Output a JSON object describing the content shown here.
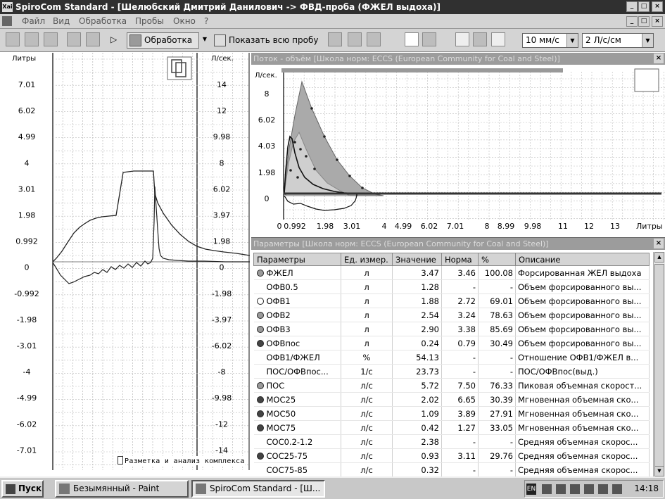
{
  "window": {
    "app_icon": "Xai",
    "title": "SpiroCom Standard - [Шелюбский Дмитрий Данилович -> ФВД-проба (ФЖЕЛ выдоха)]",
    "controls": [
      "_",
      "□",
      "×"
    ],
    "doc_controls": [
      "_",
      "□",
      "×"
    ]
  },
  "menu": [
    "Файл",
    "Вид",
    "Обработка",
    "Пробы",
    "Окно",
    "?"
  ],
  "toolbar": {
    "process_label": "Обработка",
    "show_label": "Показать всю пробу",
    "speed": "10 мм/с",
    "scale": "2 Л/с/см"
  },
  "volume_time": {
    "left_unit": "Литры",
    "right_unit": "Л/сек.",
    "left_ticks": [
      "7.01",
      "6.02",
      "4.99",
      "4",
      "3.01",
      "1.98",
      "0.992",
      "0",
      "-0.992",
      "-1.98",
      "-3.01",
      "-4",
      "-4.99",
      "-6.02",
      "-7.01"
    ],
    "right_ticks": [
      "14",
      "12",
      "9.98",
      "8",
      "6.02",
      "3.97",
      "1.98",
      "0",
      "-1.98",
      "-3.97",
      "-6.02",
      "-8",
      "-9.98",
      "-12",
      "-14"
    ],
    "hint": "Разметка и анализ комплекса"
  },
  "flow_volume": {
    "title": "Поток - объём   [Школа норм: ECCS (European Community for Coal and Steel)]",
    "y_unit": "Л/сек.",
    "y_ticks": [
      "8",
      "6.02",
      "4.03",
      "1.98",
      "0"
    ],
    "x_ticks": [
      "0",
      "0.992",
      "1.98",
      "3.01",
      "4",
      "4.99",
      "6.02",
      "7.01",
      "8",
      "8.99",
      "9.98",
      "11",
      "12",
      "13"
    ],
    "x_unit": "Литры"
  },
  "params": {
    "title": "Параметры   [Школа норм: ECCS (European Community for Coal and Steel)]",
    "columns": [
      "Параметры",
      "Ед. измер.",
      "Значение",
      "Норма",
      "%",
      "Описание"
    ],
    "rows": [
      {
        "marker": "gray",
        "name": "ФЖЕЛ",
        "unit": "л",
        "value": "3.47",
        "norm": "3.46",
        "pct": "100.08",
        "desc": "Форсированная ЖЕЛ выдоха"
      },
      {
        "marker": "",
        "name": "ОФВ0.5",
        "unit": "л",
        "value": "1.28",
        "norm": "-",
        "pct": "-",
        "desc": "Объем форсированного вы..."
      },
      {
        "marker": "white",
        "name": "ОФВ1",
        "unit": "л",
        "value": "1.88",
        "norm": "2.72",
        "pct": "69.01",
        "desc": "Объем форсированного вы..."
      },
      {
        "marker": "gray",
        "name": "ОФВ2",
        "unit": "л",
        "value": "2.54",
        "norm": "3.24",
        "pct": "78.63",
        "desc": "Объем форсированного вы..."
      },
      {
        "marker": "gray",
        "name": "ОФВ3",
        "unit": "л",
        "value": "2.90",
        "norm": "3.38",
        "pct": "85.69",
        "desc": "Объем форсированного вы..."
      },
      {
        "marker": "dark",
        "name": "ОФВпос",
        "unit": "л",
        "value": "0.24",
        "norm": "0.79",
        "pct": "30.49",
        "desc": "Объем форсированного вы..."
      },
      {
        "marker": "",
        "name": "ОФВ1/ФЖЕЛ",
        "unit": "%",
        "value": "54.13",
        "norm": "-",
        "pct": "-",
        "desc": "Отношение ОФВ1/ФЖЕЛ в..."
      },
      {
        "marker": "",
        "name": "ПОС/ОФВпос...",
        "unit": "1/с",
        "value": "23.73",
        "norm": "-",
        "pct": "-",
        "desc": "ПОС/ОФВпос(выд.)"
      },
      {
        "marker": "gray",
        "name": "ПОС",
        "unit": "л/с",
        "value": "5.72",
        "norm": "7.50",
        "pct": "76.33",
        "desc": "Пиковая объемная скорост..."
      },
      {
        "marker": "dark",
        "name": "МОС25",
        "unit": "л/с",
        "value": "2.02",
        "norm": "6.65",
        "pct": "30.39",
        "desc": "Мгновенная объемная ско..."
      },
      {
        "marker": "dark",
        "name": "МОС50",
        "unit": "л/с",
        "value": "1.09",
        "norm": "3.89",
        "pct": "27.91",
        "desc": "Мгновенная объемная ско..."
      },
      {
        "marker": "dark",
        "name": "МОС75",
        "unit": "л/с",
        "value": "0.42",
        "norm": "1.27",
        "pct": "33.05",
        "desc": "Мгновенная объемная ско..."
      },
      {
        "marker": "",
        "name": "СОС0.2-1.2",
        "unit": "л/с",
        "value": "2.38",
        "norm": "-",
        "pct": "-",
        "desc": "Средняя объемная скорос..."
      },
      {
        "marker": "dark",
        "name": "СОС25-75",
        "unit": "л/с",
        "value": "0.93",
        "norm": "3.11",
        "pct": "29.76",
        "desc": "Средняя объемная скорос..."
      },
      {
        "marker": "",
        "name": "СОС75-85",
        "unit": "л/с",
        "value": "0.32",
        "norm": "-",
        "pct": "-",
        "desc": "Средняя объемная скорос..."
      }
    ]
  },
  "taskbar": {
    "start": "Пуск",
    "tasks": [
      "Безымянный - Paint",
      "SpiroCom Standard - [Ш..."
    ],
    "lang": "EN",
    "time": "14:18"
  }
}
